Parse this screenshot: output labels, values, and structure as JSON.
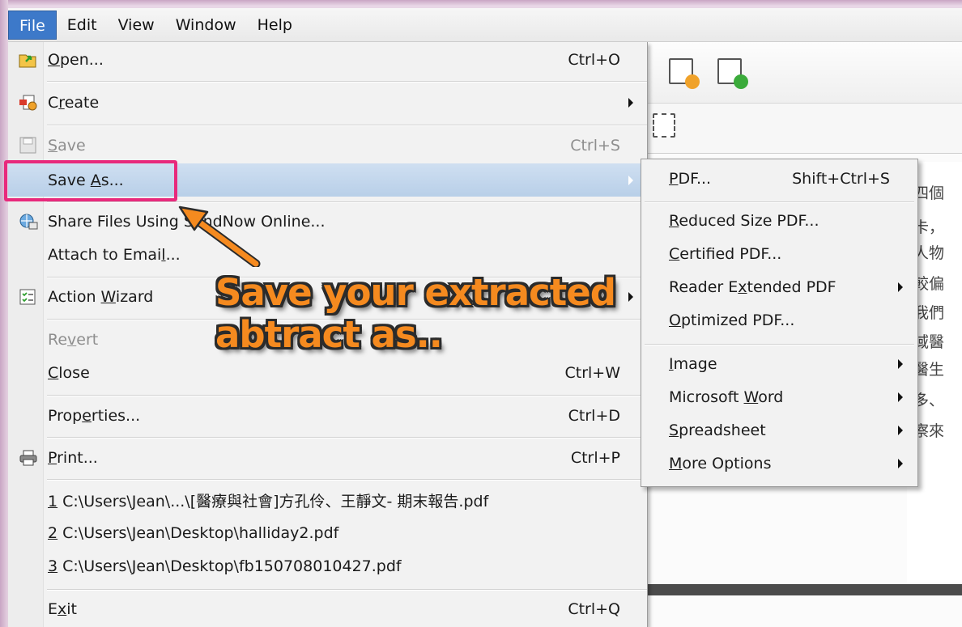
{
  "menubar": {
    "items": [
      "File",
      "Edit",
      "View",
      "Window",
      "Help"
    ],
    "active": "File"
  },
  "file_menu": {
    "open": {
      "label_pre": "",
      "mnemonic": "O",
      "label_post": "pen...",
      "shortcut": "Ctrl+O",
      "icon": "open-folder-icon"
    },
    "create": {
      "label_pre": "C",
      "mnemonic": "r",
      "label_post": "eate",
      "icon": "create-document-icon"
    },
    "save": {
      "label_pre": "",
      "mnemonic": "S",
      "label_post": "ave",
      "shortcut": "Ctrl+S",
      "icon": "save-disk-icon",
      "disabled": true
    },
    "save_as": {
      "label_pre": "Save ",
      "mnemonic": "A",
      "label_post": "s..."
    },
    "share": {
      "label": "Share Files Using SendNow Online...",
      "icon": "share-globe-icon"
    },
    "attach": {
      "label_pre": "Attach to Emai",
      "mnemonic": "l",
      "label_post": "..."
    },
    "action_wizard": {
      "label_pre": "Action ",
      "mnemonic": "W",
      "label_post": "izard",
      "icon": "action-wizard-icon"
    },
    "revert": {
      "label_pre": "Re",
      "mnemonic": "v",
      "label_post": "ert",
      "disabled": true
    },
    "close": {
      "label_pre": "",
      "mnemonic": "C",
      "label_post": "lose",
      "shortcut": "Ctrl+W"
    },
    "properties": {
      "label_pre": "Prop",
      "mnemonic": "e",
      "label_post": "rties...",
      "shortcut": "Ctrl+D"
    },
    "print": {
      "label_pre": "",
      "mnemonic": "P",
      "label_post": "rint...",
      "shortcut": "Ctrl+P",
      "icon": "printer-icon"
    },
    "recent": [
      {
        "num": "1",
        "path": " C:\\Users\\Jean\\...\\[醫療與社會]方孔伶、王靜文- 期末報告.pdf"
      },
      {
        "num": "2",
        "path": " C:\\Users\\Jean\\Desktop\\halliday2.pdf"
      },
      {
        "num": "3",
        "path": " C:\\Users\\Jean\\Desktop\\fb150708010427.pdf"
      }
    ],
    "exit": {
      "label_pre": "E",
      "mnemonic": "x",
      "label_post": "it",
      "shortcut": "Ctrl+Q"
    }
  },
  "save_as_submenu": {
    "pdf": {
      "label_pre": "",
      "mnemonic": "P",
      "label_post": "DF...",
      "shortcut": "Shift+Ctrl+S"
    },
    "reduced": {
      "label_pre": "",
      "mnemonic": "R",
      "label_post": "educed Size PDF..."
    },
    "certified": {
      "label_pre": "",
      "mnemonic": "C",
      "label_post": "ertified PDF..."
    },
    "reader_extended": {
      "label_pre": "Reader E",
      "mnemonic": "x",
      "label_post": "tended PDF"
    },
    "optimized": {
      "label_pre": "",
      "mnemonic": "O",
      "label_post": "ptimized PDF..."
    },
    "image": {
      "label_pre": "",
      "mnemonic": "I",
      "label_post": "mage"
    },
    "word": {
      "label_pre": "Microsoft ",
      "mnemonic": "W",
      "label_post": "ord"
    },
    "spreadsheet": {
      "label_pre": "",
      "mnemonic": "S",
      "label_post": "preadsheet"
    },
    "more": {
      "label_pre": "",
      "mnemonic": "M",
      "label_post": "ore Options"
    }
  },
  "annotation": {
    "callout_line1": "Save your extracted",
    "callout_line2": "abtract as..",
    "highlight_color": "#e8297c",
    "callout_color": "#f58a1f"
  },
  "document_text": [
    "四個",
    "卡，",
    "人物",
    "較偏",
    "我們",
    "域醫",
    "醫生",
    "多、",
    "察來"
  ],
  "colors": {
    "menu_active": "#3d79c9",
    "menu_highlight": "#b8cfe8"
  }
}
